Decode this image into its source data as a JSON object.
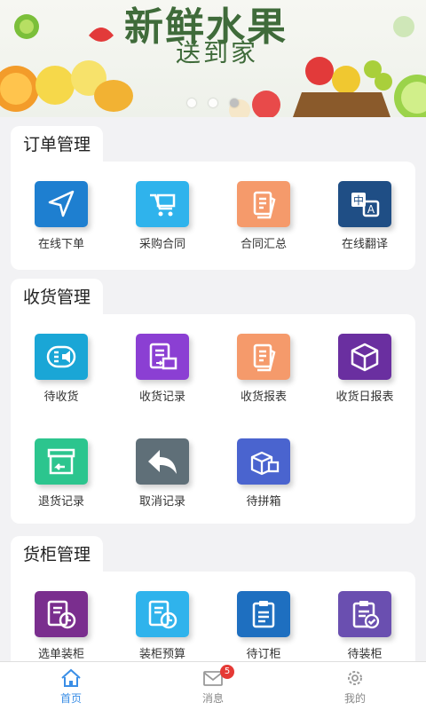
{
  "banner": {
    "title": "新鲜水果",
    "subtitle": "送到家",
    "dots": 3,
    "active_dot": 2
  },
  "colors": {
    "blue": "#1e7fd0",
    "cyan": "#2fb3ec",
    "orange": "#f59a6b",
    "navy": "#1f4e85",
    "purple": "#8b3fd3",
    "violet": "#6a2fa0",
    "green": "#2cc58e",
    "slate": "#5f6f78",
    "indigo": "#4a64cf",
    "accent": "#3a8ee6",
    "badge": "#e53935"
  },
  "sections": [
    {
      "title": "订单管理",
      "items": [
        {
          "label": "在线下单",
          "icon": "navigation-arrow-icon",
          "color": "#1e7fd0"
        },
        {
          "label": "采购合同",
          "icon": "cart-icon",
          "color": "#2fb3ec"
        },
        {
          "label": "合同汇总",
          "icon": "documents-icon",
          "color": "#f59a6b"
        },
        {
          "label": "在线翻译",
          "icon": "translate-icon",
          "color": "#1f4e85"
        }
      ]
    },
    {
      "title": "收货管理",
      "items": [
        {
          "label": "待收货",
          "icon": "list-speaker-icon",
          "color": "#1aa6d6"
        },
        {
          "label": "收货记录",
          "icon": "record-box-icon",
          "color": "#8b3fd3"
        },
        {
          "label": "收货报表",
          "icon": "documents-icon",
          "color": "#f59a6b"
        },
        {
          "label": "收货日报表",
          "icon": "box-icon",
          "color": "#6a2fa0"
        },
        {
          "label": "退货记录",
          "icon": "return-box-icon",
          "color": "#2cc58e"
        },
        {
          "label": "取消记录",
          "icon": "undo-arrow-icon",
          "color": "#5f6f78"
        },
        {
          "label": "待拼箱",
          "icon": "boxes-icon",
          "color": "#4a64cf"
        }
      ]
    },
    {
      "title": "货柜管理",
      "items": [
        {
          "label": "选单装柜",
          "icon": "clock-document-icon",
          "color": "#7a2e8e"
        },
        {
          "label": "装柜预算",
          "icon": "clock-document-icon",
          "color": "#2fb3ec"
        },
        {
          "label": "待订柜",
          "icon": "clipboard-icon",
          "color": "#1e6fc0"
        },
        {
          "label": "待装柜",
          "icon": "clipboard-check-icon",
          "color": "#6a4fb0"
        }
      ]
    }
  ],
  "tabbar": [
    {
      "label": "首页",
      "icon": "home-icon",
      "active": true
    },
    {
      "label": "消息",
      "icon": "mail-icon",
      "badge": "5"
    },
    {
      "label": "我的",
      "icon": "gear-icon"
    }
  ]
}
